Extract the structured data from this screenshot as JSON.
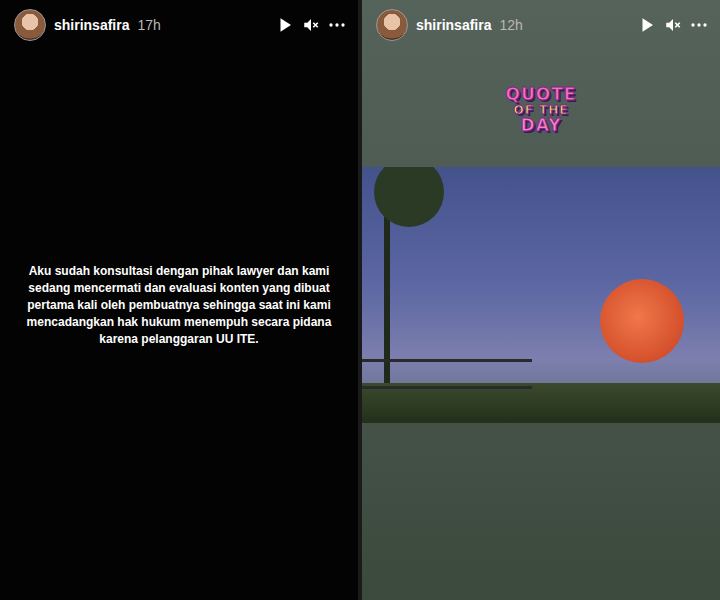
{
  "stories": [
    {
      "kind": "text",
      "username": "shirinsafira",
      "time": "17h",
      "text": "Aku sudah konsultasi dengan pihak lawyer dan kami sedang mencermati dan evaluasi konten yang dibuat pertama kali oleh pembuatnya sehingga saat ini kami mencadangkan hak hukum menempuh secara pidana karena pelanggaran UU ITE."
    },
    {
      "kind": "quote",
      "username": "shirinsafira",
      "time": "12h",
      "sticker": [
        "QUOTE",
        "OF THE",
        "DAY"
      ]
    }
  ]
}
